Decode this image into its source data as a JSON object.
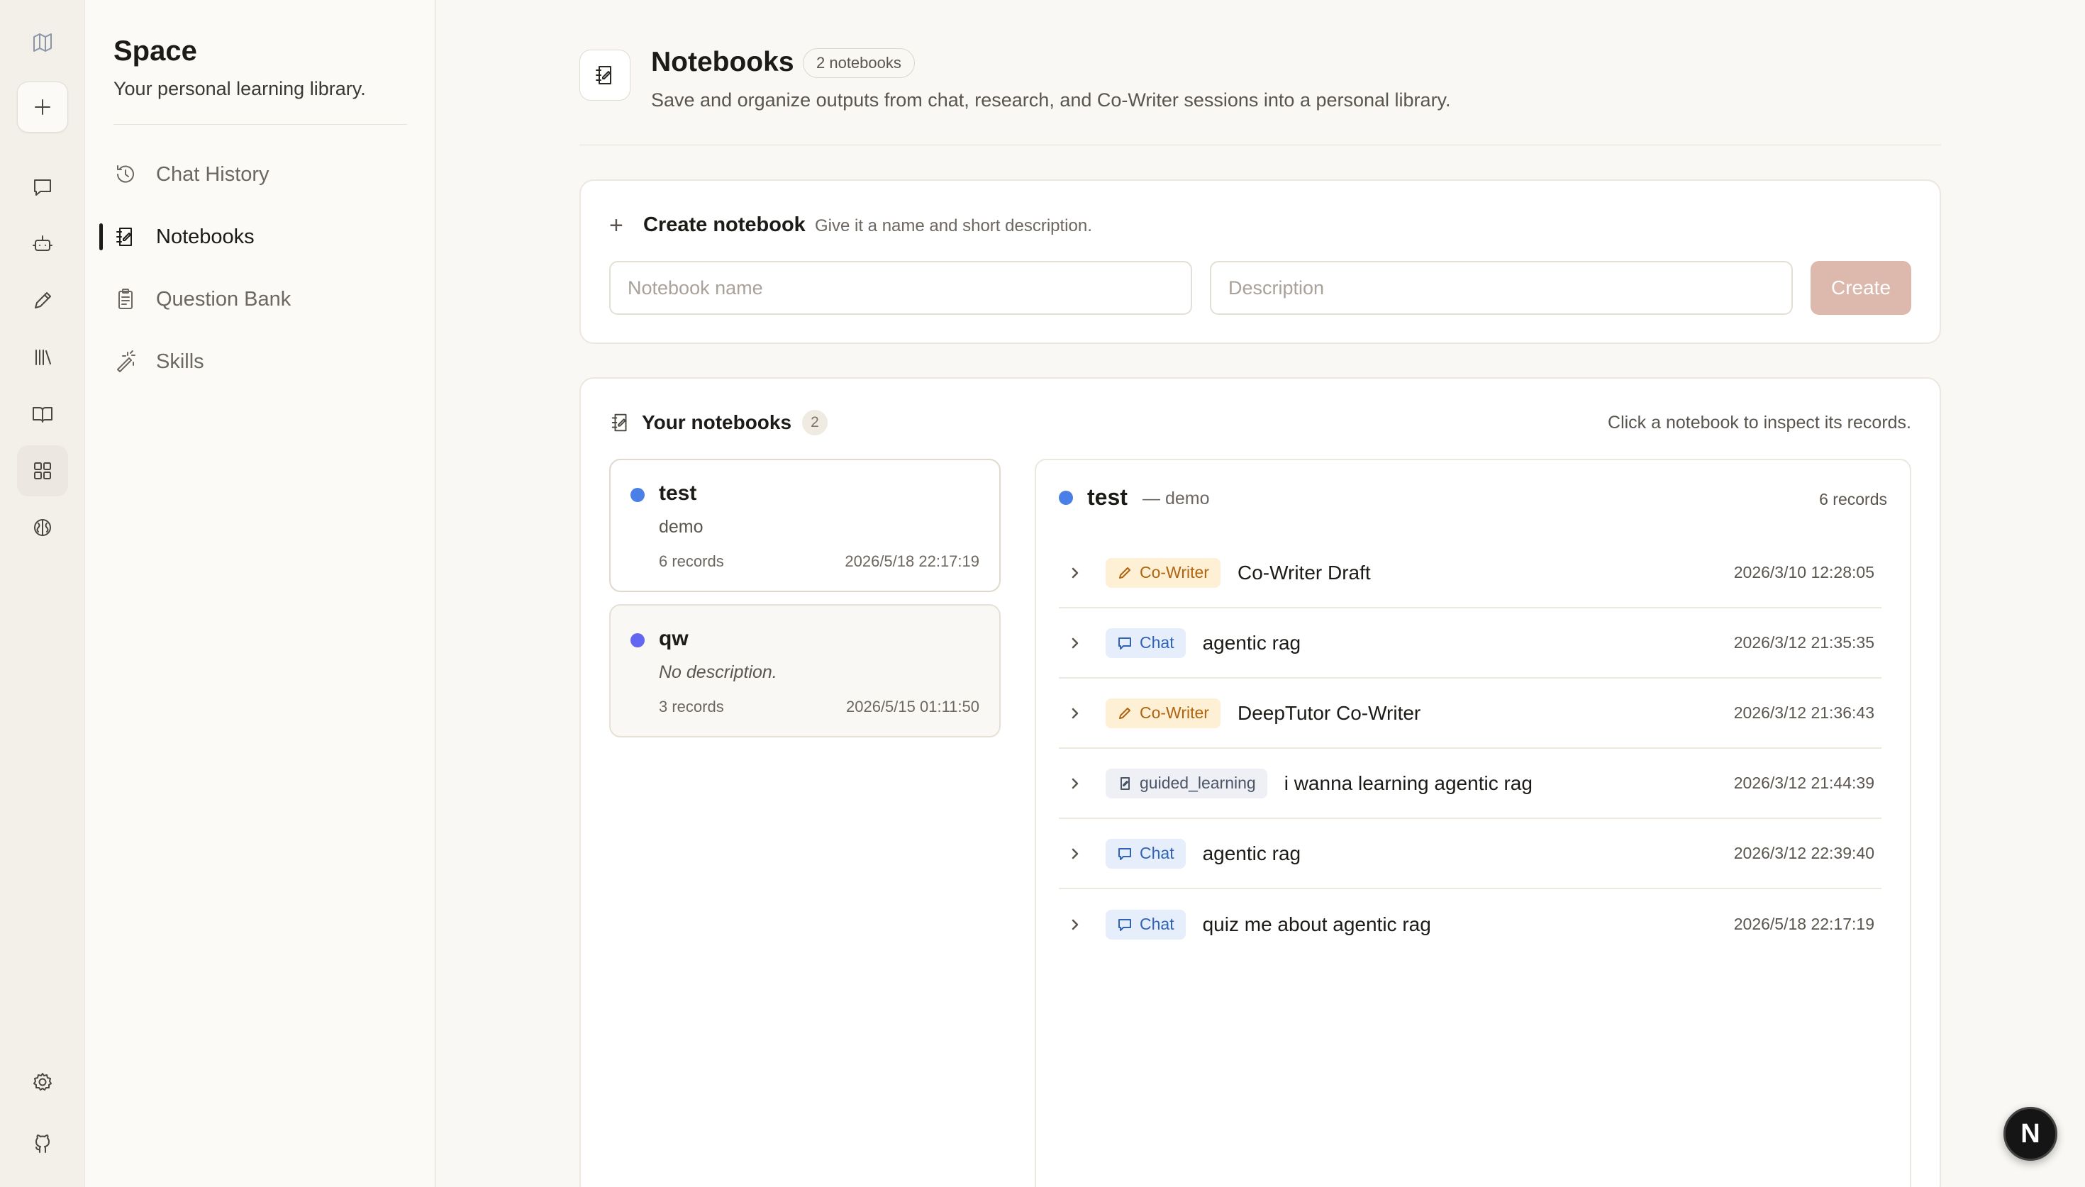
{
  "rail": {
    "items": [
      {
        "icon": "logo-icon"
      },
      {
        "icon": "plus-icon"
      },
      {
        "icon": "chat-icon"
      },
      {
        "icon": "robot-icon"
      },
      {
        "icon": "pen-icon"
      },
      {
        "icon": "library-icon"
      },
      {
        "icon": "book-icon"
      },
      {
        "icon": "grid-icon"
      },
      {
        "icon": "brain-icon"
      },
      {
        "icon": "gear-icon"
      },
      {
        "icon": "github-icon"
      }
    ]
  },
  "sidebar": {
    "title": "Space",
    "subtitle": "Your personal learning library.",
    "items": [
      {
        "label": "Chat History",
        "icon": "history-icon"
      },
      {
        "label": "Notebooks",
        "icon": "notebook-icon",
        "active": true
      },
      {
        "label": "Question Bank",
        "icon": "clipboard-icon"
      },
      {
        "label": "Skills",
        "icon": "wand-icon"
      }
    ]
  },
  "header": {
    "title": "Notebooks",
    "badge": "2 notebooks",
    "description": "Save and organize outputs from chat, research, and Co-Writer sessions into a personal library."
  },
  "create": {
    "plus": "+",
    "title": "Create notebook",
    "subtitle": "Give it a name and short description.",
    "name_placeholder": "Notebook name",
    "desc_placeholder": "Description",
    "button": "Create"
  },
  "list": {
    "title": "Your notebooks",
    "count": "2",
    "hint": "Click a notebook to inspect its records.",
    "notebooks": [
      {
        "name": "test",
        "description": "demo",
        "records": "6 records",
        "date": "2026/5/18 22:17:19",
        "color": "#4b7fe8"
      },
      {
        "name": "qw",
        "description": "No description.",
        "records": "3 records",
        "date": "2026/5/15 01:11:50",
        "color": "#6366f1"
      }
    ]
  },
  "detail": {
    "name": "test",
    "subtitle": "— demo",
    "records_count": "6 records",
    "records": [
      {
        "tag": "Co-Writer",
        "title": "Co-Writer Draft",
        "date": "2026/3/10 12:28:05"
      },
      {
        "tag": "Chat",
        "title": "agentic rag",
        "date": "2026/3/12 21:35:35"
      },
      {
        "tag": "Co-Writer",
        "title": "DeepTutor Co-Writer",
        "date": "2026/3/12 21:36:43"
      },
      {
        "tag": "guided_learning",
        "title": "i wanna learning agentic rag",
        "date": "2026/3/12 21:44:39"
      },
      {
        "tag": "Chat",
        "title": "agentic rag",
        "date": "2026/3/12 22:39:40"
      },
      {
        "tag": "Chat",
        "title": "quiz me about agentic rag",
        "date": "2026/5/18 22:17:19"
      }
    ]
  },
  "fab": {
    "label": "N"
  }
}
